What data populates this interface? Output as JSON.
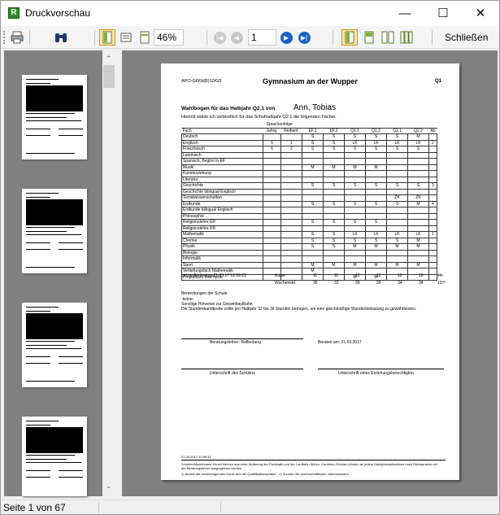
{
  "window": {
    "title": "Druckvorschau",
    "icon_letter": "R",
    "minimize": "—",
    "maximize": "☐",
    "close": "✕"
  },
  "toolbar": {
    "zoom": "46%",
    "page_number": "1",
    "close_label": "Schließen"
  },
  "status": {
    "text": "Seite 1 von 67"
  },
  "document": {
    "header_left": "APO-GOSt(B)10/G5",
    "title": "Gymnasium an der Wupper",
    "header_right": "Q1",
    "heading": "Wahlbogen für das Halbjahr Q2.1 von",
    "student": "Ann, Tobias",
    "intro": "Hiermit wähle ich verbindlich für das Schulhalbjahr Q2.1 die folgenden Fächer.",
    "table": {
      "header_top": "Sprachenfolge",
      "headers": [
        "Fach",
        "Jahrg.",
        "Reihenf.",
        "EF.1",
        "EF.2",
        "Q1.1",
        "Q1.2",
        "Q2.1",
        "Q2.2",
        "Ab"
      ],
      "rows": [
        [
          "Deutsch",
          "",
          "",
          "S",
          "S",
          "S",
          "S",
          "S",
          "M",
          ""
        ],
        [
          "Englisch",
          "5",
          "1",
          "S",
          "S",
          "LK",
          "LK",
          "LK",
          "LK",
          "2"
        ],
        [
          "Französisch",
          "6",
          "2",
          "S",
          "S",
          "S",
          "S",
          "S",
          "S",
          ""
        ],
        [
          "Lateinisch",
          "",
          "",
          "",
          "",
          "",
          "",
          "",
          "",
          ""
        ],
        [
          "Spanisch, Beginn in EF",
          "",
          "",
          "",
          "",
          "",
          "",
          "",
          "",
          ""
        ],
        [
          "Musik",
          "",
          "",
          "M",
          "M",
          "M",
          "M",
          "",
          "",
          ""
        ],
        [
          "Kunsterziehung",
          "",
          "",
          "",
          "",
          "",
          "",
          "",
          "",
          ""
        ],
        [
          "Literatur",
          "",
          "",
          "",
          "",
          "",
          "",
          "",
          "",
          ""
        ],
        [
          "Geschichte",
          "",
          "",
          "S",
          "S",
          "S",
          "S",
          "S",
          "S",
          "3"
        ],
        [
          "Geschichte bilingual Englisch",
          "",
          "",
          "",
          "",
          "",
          "",
          "",
          "",
          ""
        ],
        [
          "Sozialwissenschaften",
          "",
          "",
          "",
          "",
          "",
          "",
          "ZK",
          "ZK",
          ""
        ],
        [
          "Erdkunde",
          "",
          "",
          "S",
          "S",
          "S",
          "S",
          "S",
          "M",
          "4"
        ],
        [
          "Erdkunde bilingual Englisch",
          "",
          "",
          "",
          "",
          "",
          "",
          "",
          "",
          ""
        ],
        [
          "Philosophie",
          "",
          "",
          "",
          "",
          "",
          "",
          "",
          "",
          ""
        ],
        [
          "Religionslehre ER",
          "",
          "",
          "S",
          "S",
          "S",
          "S",
          "",
          "",
          ""
        ],
        [
          "Religionslehre KR",
          "",
          "",
          "",
          "",
          "",
          "",
          "",
          "",
          ""
        ],
        [
          "Mathematik",
          "",
          "",
          "S",
          "S",
          "LK",
          "LK",
          "LK",
          "LK",
          "1"
        ],
        [
          "Chemie",
          "",
          "",
          "S",
          "S",
          "S",
          "S",
          "S",
          "M",
          ""
        ],
        [
          "Physik",
          "",
          "",
          "S",
          "S",
          "M",
          "M",
          "M",
          "M",
          ""
        ],
        [
          "Biologie",
          "",
          "",
          "",
          "",
          "",
          "",
          "",
          "",
          ""
        ],
        [
          "Informatik",
          "",
          "",
          "",
          "",
          "",
          "",
          "",
          "",
          ""
        ],
        [
          "Sport",
          "",
          "",
          "M",
          "M",
          "M",
          "M",
          "M",
          "M",
          ""
        ],
        [
          "Vertiefungsfach Mathematik",
          "",
          "",
          "M",
          "",
          "",
          "",
          "",
          "",
          ""
        ],
        [
          "Projektkurs BioPhysik",
          "",
          "",
          "",
          "",
          "M",
          "M",
          "",
          "",
          ""
        ]
      ]
    },
    "last_change": "Letzte Änderung:   21.03.17 12:59:23",
    "kurse_label": "Kurse",
    "kurse_values": [
      "11",
      "11",
      "12",
      "12",
      "10",
      "10",
      "44¹"
    ],
    "wochen_label": "Wochenstd.",
    "wochen_values": [
      "35",
      "33",
      "39",
      "39",
      "34",
      "34",
      "107²"
    ],
    "remarks_title": "Bemerkungen der Schule",
    "remarks_value": "-keine-",
    "hints_title": "Sonstige Hinweise zur Gesamtlaufbahn",
    "hints_text": "Die Stundenbandbreite sollte pro Halbjahr 32 bis 36 Stunden betragen, um eine gleichmäßige Stundenbelastung zu gewährleisten.",
    "advisor": "Beratungslehrer:    Raffenberg",
    "advised_on": "Beraten am:  21.03.2017",
    "sig_student": "Unterschrift des Schülers",
    "sig_parent": "Unterschrift eines Erziehungsberechtigten",
    "footer_date": "21.03.2017 12:59:41",
    "footer_note": "Schulrechtsrelevante Kürzel können aus einer Änderung der Fachwahl und der Laufbahn führen. Korrektur-Zeichen können an jedem Halbjahresabschluss nach Rücksprache mit der Beratungslehrer ausgeglichen werden.",
    "footer_fn1": "1) Anzahl der einzubringenden Kurse aus der Qualifikationsphase",
    "footer_fn2": "2) Summe der durchschnittlichen Jahresstunden"
  }
}
